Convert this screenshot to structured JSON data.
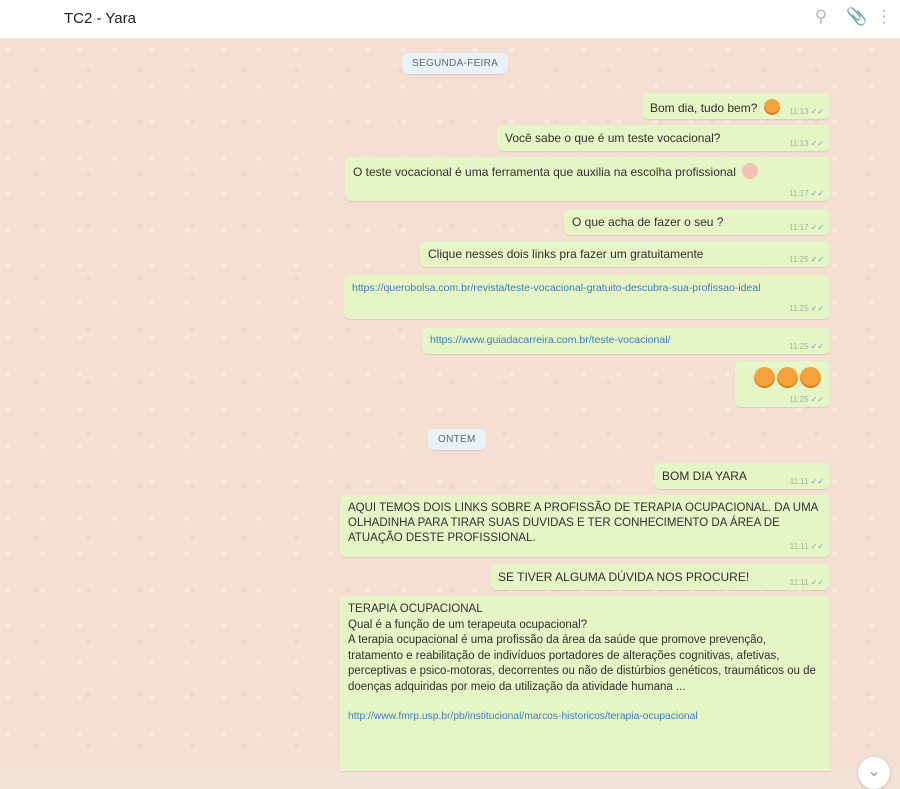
{
  "header": {
    "title": "TC2 - Yara",
    "search_icon": "search-icon",
    "attach_icon": "paperclip-icon",
    "menu_icon": "more-vert-icon"
  },
  "days": {
    "monday": "SEGUNDA-FEIRA",
    "yesterday": "ONTEM"
  },
  "messages": [
    {
      "text": "Bom dia, tudo bem?",
      "time": "11:13"
    },
    {
      "text": "Você sabe o que é um teste vocacional?",
      "time": "11:13"
    },
    {
      "text": "O teste vocacional é uma ferramenta que auxilia na escolha profissional",
      "time": "11:17"
    },
    {
      "text": "O que acha de fazer o seu ?",
      "time": "11:17"
    },
    {
      "text": "Clique nesses dois links pra fazer um gratuitamente",
      "time": "11:25"
    },
    {
      "text": "https://querobolsa.com.br/revista/teste-vocacional-gratuito-descubra-sua-profissao-ideal",
      "time": "11:25"
    },
    {
      "text": "https://www.guiadacarreira.com.br/teste-vocacional/",
      "time": "11:25"
    },
    {
      "text": "",
      "time": "11:25"
    },
    {
      "text": "BOM DIA YARA",
      "time": "11:11"
    },
    {
      "text": "AQUI TEMOS DOIS LINKS SOBRE A PROFISSÃO DE TERAPIA OCUPACIONAL. DA UMA OLHADINHA PARA TIRAR SUAS DUVIDAS E TER CONHECIMENTO DA ÁREA DE ATUAÇÃO DESTE PROFISSIONAL.",
      "time": "11:11"
    },
    {
      "text": "SE TIVER ALGUMA DÚVIDA NOS PROCURE!",
      "time": "11:11"
    },
    {
      "line1": "TERAPIA OCUPACIONAL",
      "line2": "Qual é a função de um terapeuta ocupacional?",
      "body": "A terapia ocupacional é uma profissão da área da saúde que promove prevenção, tratamento e reabilitação de indivíduos portadores de alterações cognitivas, afetivas, perceptivas e psico-motoras, decorrentes ou não de distúrbios genéticos, traumáticos ou de doenças adquiridas por meio da utilização da atividade humana ...",
      "link": "http://www.fmrp.usp.br/pb/institucional/marcos-historicos/terapia-ocupacional"
    }
  ],
  "scroll_icon": "chevron-down-icon",
  "colors": {
    "bubble": "#e6f5c5",
    "background": "#f4dfd2",
    "link": "#3d7cc4",
    "tick": "#56a7d6"
  }
}
